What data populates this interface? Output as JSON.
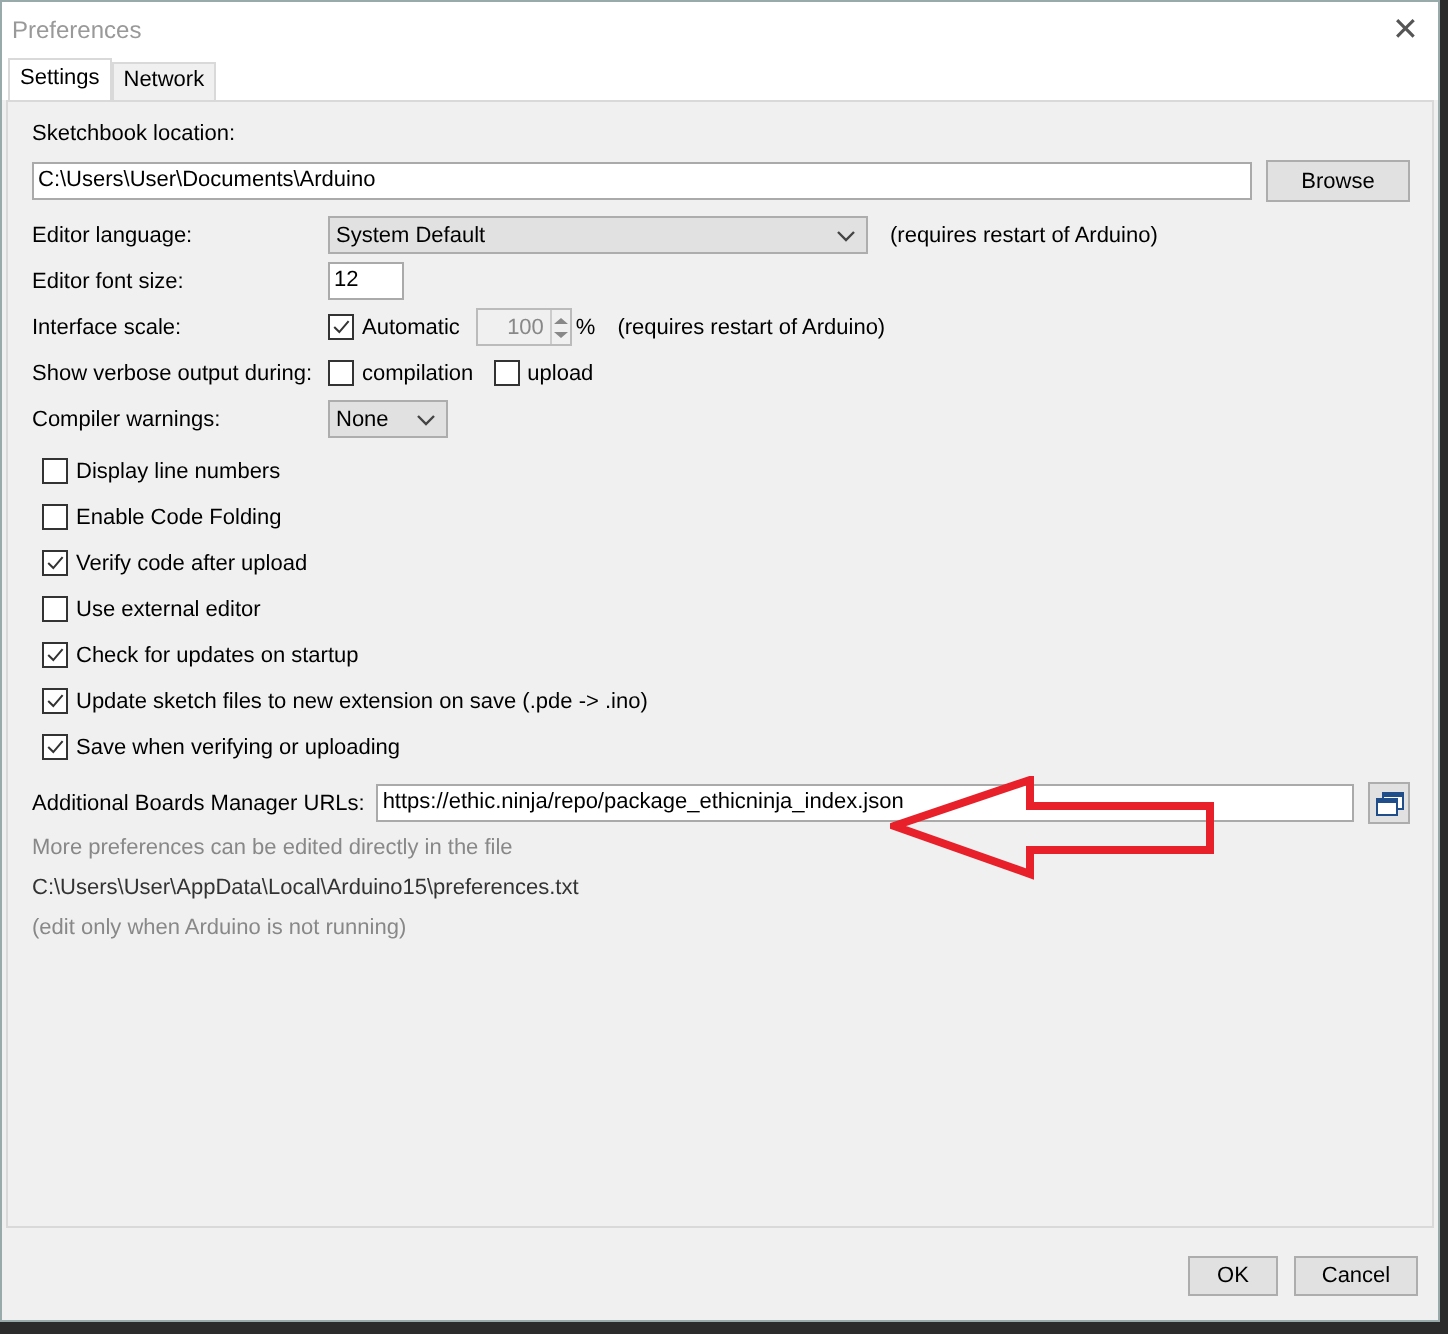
{
  "window": {
    "title": "Preferences",
    "close": "✕"
  },
  "tabs": [
    {
      "label": "Settings",
      "selected": true
    },
    {
      "label": "Network",
      "selected": false
    }
  ],
  "sketchbook": {
    "label": "Sketchbook location:",
    "value": "C:\\Users\\User\\Documents\\Arduino",
    "button": "Browse"
  },
  "editor_language": {
    "label": "Editor language:",
    "value": "System Default",
    "note": "(requires restart of Arduino)"
  },
  "editor_font_size": {
    "label": "Editor font size:",
    "value": "12"
  },
  "interface_scale": {
    "label": "Interface scale:",
    "automatic": {
      "label": "Automatic",
      "checked": true
    },
    "value": "100",
    "disabled": true,
    "unit": "%",
    "note": "(requires restart of Arduino)"
  },
  "verbose": {
    "label": "Show verbose output during:",
    "options": [
      {
        "label": "compilation",
        "checked": false
      },
      {
        "label": "upload",
        "checked": false
      }
    ]
  },
  "compiler_warnings": {
    "label": "Compiler warnings:",
    "value": "None"
  },
  "options": [
    {
      "label": "Display line numbers",
      "checked": false
    },
    {
      "label": "Enable Code Folding",
      "checked": false
    },
    {
      "label": "Verify code after upload",
      "checked": true
    },
    {
      "label": "Use external editor",
      "checked": false
    },
    {
      "label": "Check for updates on startup",
      "checked": true
    },
    {
      "label": "Update sketch files to new extension on save (.pde -> .ino)",
      "checked": true
    },
    {
      "label": "Save when verifying or uploading",
      "checked": true
    }
  ],
  "boards_urls": {
    "label": "Additional Boards Manager URLs:",
    "value": "https://ethic.ninja/repo/package_ethicninja_index.json"
  },
  "notes": [
    {
      "text": "More preferences can be edited directly in the file",
      "kind": "hint"
    },
    {
      "text": "C:\\Users\\User\\AppData\\Local\\Arduino15\\preferences.txt",
      "kind": "path"
    },
    {
      "text": "(edit only when Arduino is not running)",
      "kind": "hint"
    }
  ],
  "buttons": [
    "OK",
    "Cancel"
  ]
}
